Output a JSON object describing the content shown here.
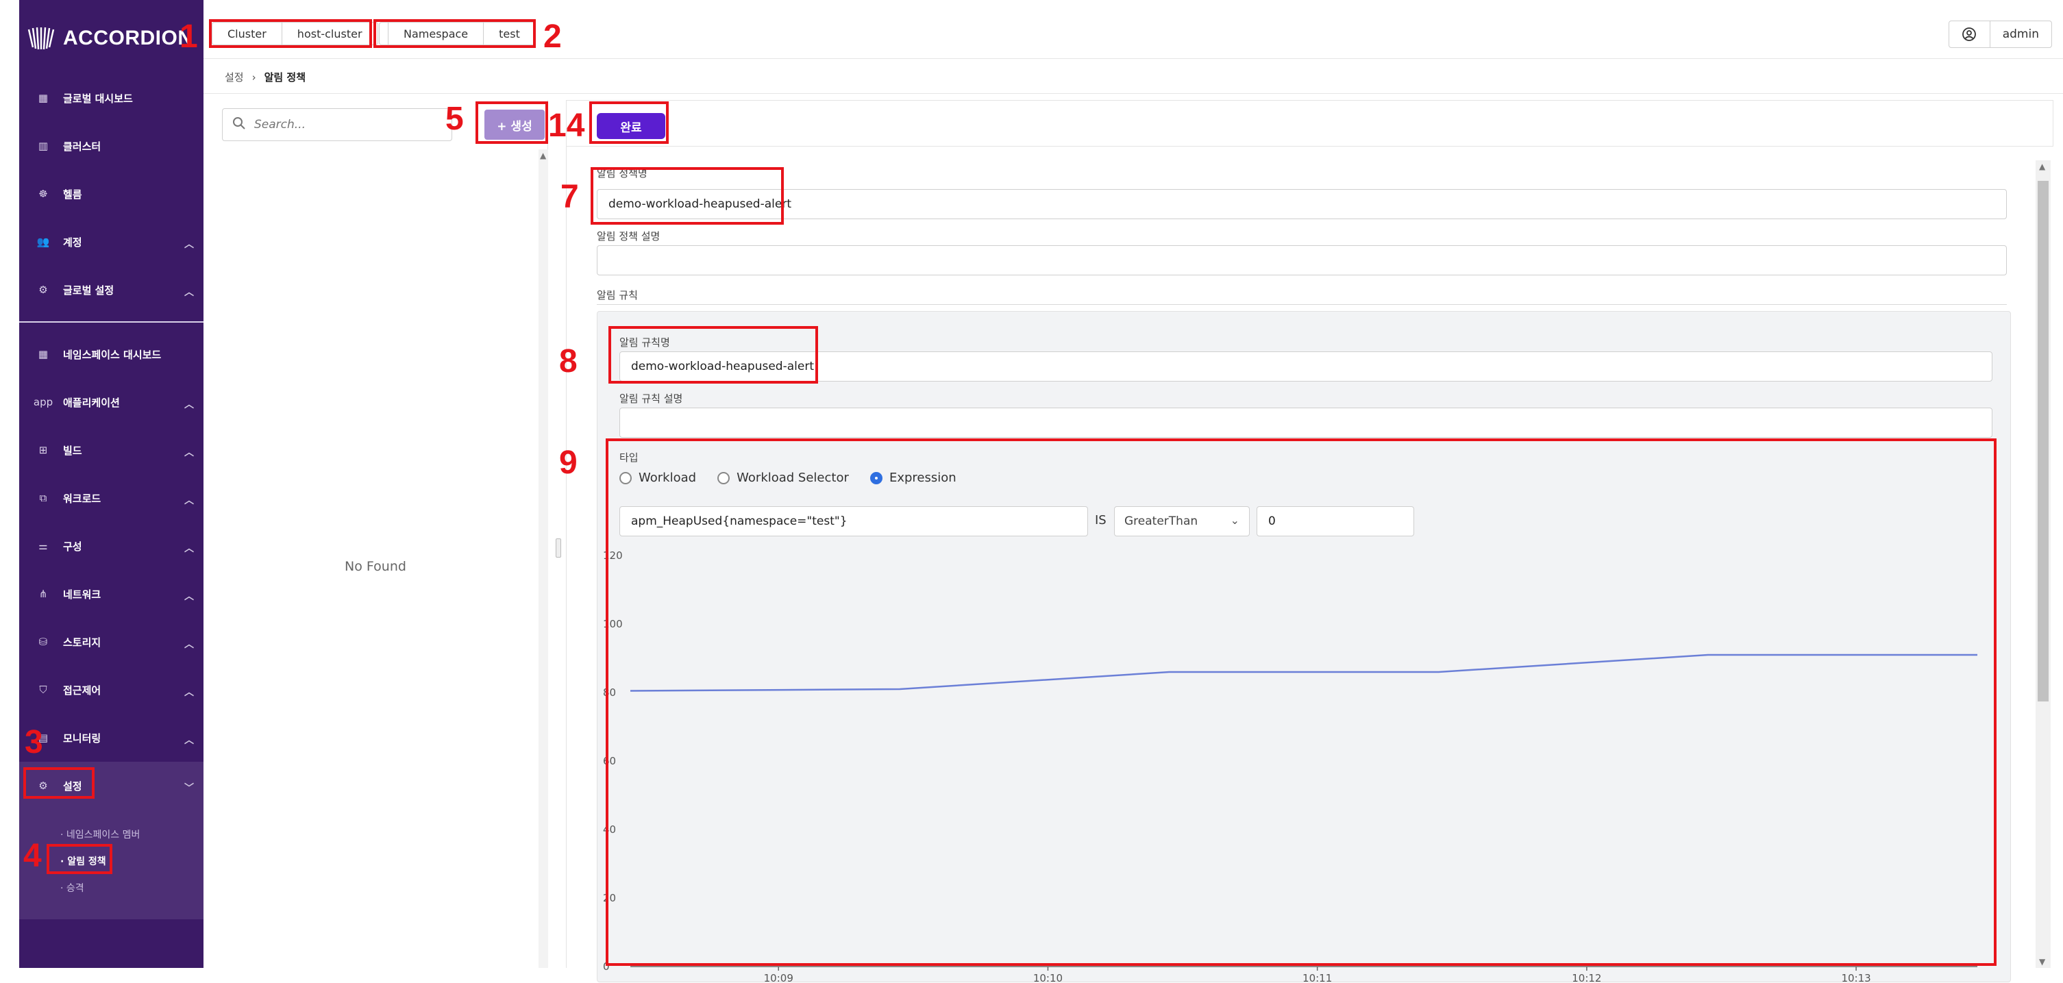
{
  "brand": {
    "name": "ACCORDION"
  },
  "topbar": {
    "cluster_label": "Cluster",
    "cluster_value": "host-cluster",
    "namespace_label": "Namespace",
    "namespace_value": "test",
    "user": "admin"
  },
  "sidebar": {
    "items": [
      {
        "label": "글로벌 대시보드",
        "icon": "grid-icon"
      },
      {
        "label": "클러스터",
        "icon": "columns-icon"
      },
      {
        "label": "헬름",
        "icon": "helm-icon"
      },
      {
        "label": "계정",
        "icon": "users-icon"
      },
      {
        "label": "글로벌 설정",
        "icon": "gear-icon"
      }
    ],
    "lower_items": [
      {
        "label": "네임스페이스 대시보드",
        "icon": "grid-icon"
      },
      {
        "label": "애플리케이션",
        "icon_text": "app"
      },
      {
        "label": "빌드",
        "icon": "build-icon"
      },
      {
        "label": "워크로드",
        "icon": "workload-icon"
      },
      {
        "label": "구성",
        "icon": "sliders-icon"
      },
      {
        "label": "네트워크",
        "icon": "network-icon"
      },
      {
        "label": "스토리지",
        "icon": "storage-icon"
      },
      {
        "label": "접근제어",
        "icon": "shield-icon"
      },
      {
        "label": "모니터링",
        "icon": "monitor-icon"
      },
      {
        "label": "설정",
        "icon": "gear-icon"
      }
    ],
    "sub_items": [
      "· 네임스페이스 멤버",
      "· 알림 정책",
      "· 승격"
    ]
  },
  "breadcrumb": {
    "parent": "설정",
    "separator": "›",
    "current": "알림 정책"
  },
  "left_panel": {
    "search_placeholder": "Search...",
    "create_label": "+ 생성",
    "empty_text": "No Found"
  },
  "toolbar": {
    "done_label": "완료"
  },
  "form": {
    "policy_name_label": "알림 정책명",
    "policy_name_value": "demo-workload-heapused-alert",
    "policy_desc_label": "알림 정책 설명",
    "rules_label": "알림 규칙",
    "rule_name_label": "알림 규칙명",
    "rule_name_value": "demo-workload-heapused-alert",
    "rule_desc_label": "알림 규칙 설명",
    "type_label": "타입",
    "type_options": [
      "Workload",
      "Workload Selector",
      "Expression"
    ],
    "type_selected": "Expression",
    "expression_value": "apm_HeapUsed{namespace=\"test\"}",
    "is_label": "IS",
    "operator_value": "GreaterThan",
    "threshold_value": "0"
  },
  "chart_data": {
    "type": "line",
    "x_ticks": [
      "10:09",
      "10:10",
      "10:11",
      "10:12",
      "10:13"
    ],
    "y_ticks": [
      0,
      20,
      40,
      60,
      80,
      100,
      120
    ],
    "ylim": [
      0,
      120
    ],
    "xlim": [
      "10:08:27",
      "10:13:27"
    ],
    "series": [
      {
        "color": "#6b7fd7",
        "x": [
          "10:08:27",
          "10:09:27",
          "10:10:27",
          "10:11:27",
          "10:12:27",
          "10:13:27"
        ],
        "values": [
          80.5,
          81,
          86,
          86,
          91,
          91
        ]
      }
    ]
  },
  "annotations": [
    "1",
    "2",
    "3",
    "4",
    "5",
    "14",
    "7",
    "8",
    "9"
  ],
  "colors": {
    "sidebar_bg": "#3b1a66",
    "primary": "#5b1ed0",
    "create_btn": "#a48bd0",
    "annotation": "#e8141b",
    "chart_line": "#6b7fd7"
  }
}
